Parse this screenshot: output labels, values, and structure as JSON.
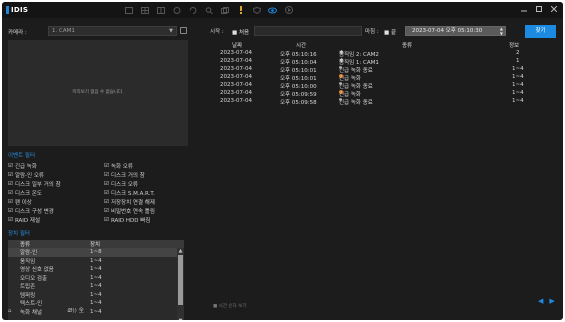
{
  "app": {
    "logo_text": "IDIS"
  },
  "toolbar": {
    "icons": [
      "layout-single-icon",
      "layout-grid-icon",
      "layout-quad-icon",
      "camera-icon",
      "rotate-icon",
      "search-icon",
      "copy-icon",
      "alert-icon",
      "shield-icon",
      "eye-icon",
      "play-icon"
    ]
  },
  "camera": {
    "label": "카메라 :",
    "selected": "1. CAM1",
    "preview_message": "미리보기 없음 수 없습니다."
  },
  "event_filter": {
    "title": "이벤트 필터",
    "left": [
      "긴급 녹화",
      "알람-인 오류",
      "디스크 일부 거의 참",
      "디스크 온도",
      "팬 이상",
      "디스크 구성 변경",
      "RAID 재설"
    ],
    "right": [
      "녹화 오류",
      "디스크 거의 참",
      "디스크 오류",
      "디스크 S.M.A.R.T.",
      "저장장치 연결 해제",
      "비밀번호 연속 틀림",
      "RAID HDD 빠짐"
    ],
    "check_mark": "☑"
  },
  "device_filter": {
    "title": "장치 필터",
    "headers": [
      "종류",
      "장치"
    ],
    "rows": [
      [
        "알람-인",
        "1~8"
      ],
      [
        "움직임",
        "1~4"
      ],
      [
        "영상 신호 없음",
        "1~4"
      ],
      [
        "오디오 검출",
        "1~4"
      ],
      [
        "트립존",
        "1~4"
      ],
      [
        "템퍼링",
        "1~4"
      ],
      [
        "텍스트-인",
        "1~4"
      ],
      [
        "녹화 채널",
        "1~4"
      ]
    ]
  },
  "search": {
    "start_label": "시작 :",
    "start_checkbox": "■ 처음",
    "end_label": "마침 :",
    "end_checkbox": "■ 끝",
    "end_value": "2023-07-04  오후 05:10:30",
    "search_button": "찾기"
  },
  "log": {
    "headers": {
      "date": "날짜",
      "time": "시간",
      "type": "종류",
      "info": "정보"
    },
    "rows": [
      {
        "date": "2023-07-04",
        "time": "오후 05:10:16",
        "marker": "star",
        "type": "움직임 2: CAM2",
        "info": "2"
      },
      {
        "date": "2023-07-04",
        "time": "오후 05:10:04",
        "marker": "star",
        "type": "움직임 1: CAM1",
        "info": "1"
      },
      {
        "date": "2023-07-04",
        "time": "오후 05:10:01",
        "marker": "gray",
        "type": "긴급 녹화 종료",
        "info": "1~4"
      },
      {
        "date": "2023-07-04",
        "time": "오후 05:10:01",
        "marker": "orange",
        "type": "긴급 녹화",
        "info": "1~4"
      },
      {
        "date": "2023-07-04",
        "time": "오후 05:10:00",
        "marker": "gray",
        "type": "긴급 녹화 종료",
        "info": "1~4"
      },
      {
        "date": "2023-07-04",
        "time": "오후 05:09:59",
        "marker": "orange",
        "type": "긴급 녹화",
        "info": "1~4"
      },
      {
        "date": "2023-07-04",
        "time": "오후 05:09:58",
        "marker": "gray",
        "type": "긴급 녹화 종료",
        "info": "1~4"
      }
    ]
  },
  "footer": {
    "home_glyph": "⌂",
    "status_text": "Ꮺ)) 全",
    "bottom_checkbox": "■ 시간 순차 보기",
    "prev": "◀",
    "next": "▶"
  },
  "colors": {
    "accent": "#1b8ae0",
    "background": "#1c1c1c",
    "panel": "#2b2b2b",
    "alarm_dot": "#e07a1f"
  }
}
